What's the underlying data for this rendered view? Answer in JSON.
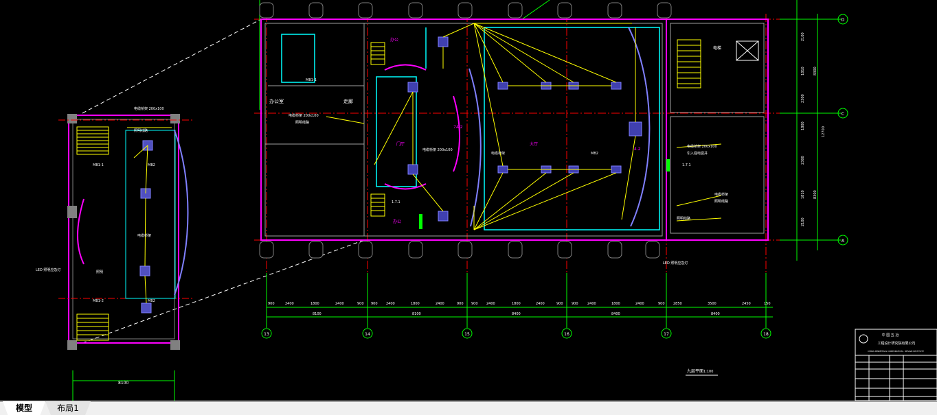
{
  "tabs": [
    {
      "label": "模型",
      "active": true
    },
    {
      "label": "布局1",
      "active": false
    }
  ],
  "axis_labels": {
    "vertical_grid": [
      "13",
      "14",
      "15",
      "16",
      "17",
      "18"
    ],
    "horizontal_grid": [
      "D",
      "C",
      "A"
    ]
  },
  "room_labels": {
    "room_a": "7.1",
    "room_b": "办公室",
    "room_c": "电梯",
    "stair_b": "走廊"
  },
  "drawing_title": "九层平面",
  "drawing_scale": "1:100",
  "dimension_labels": {
    "total_bottom": "8400",
    "seg_1": "8100",
    "seg_2": "8100",
    "seg_3": "8400",
    "seg_4": "8400"
  },
  "title_block": {
    "company_line1": "中 国 五 冶",
    "company_line2": "工程设计研究院有限公司",
    "company_line3": "CHINA MINMETALS CORPORATION - DESIGN INSTITUTE"
  },
  "colors": {
    "wall": "#ff00ff",
    "grid": "#00ff00",
    "wire": "#ffff00",
    "axis": "#ff0000",
    "cyan": "#00ffff",
    "equipment": "#8080ff",
    "text": "#ffffff",
    "background": "#000000"
  }
}
